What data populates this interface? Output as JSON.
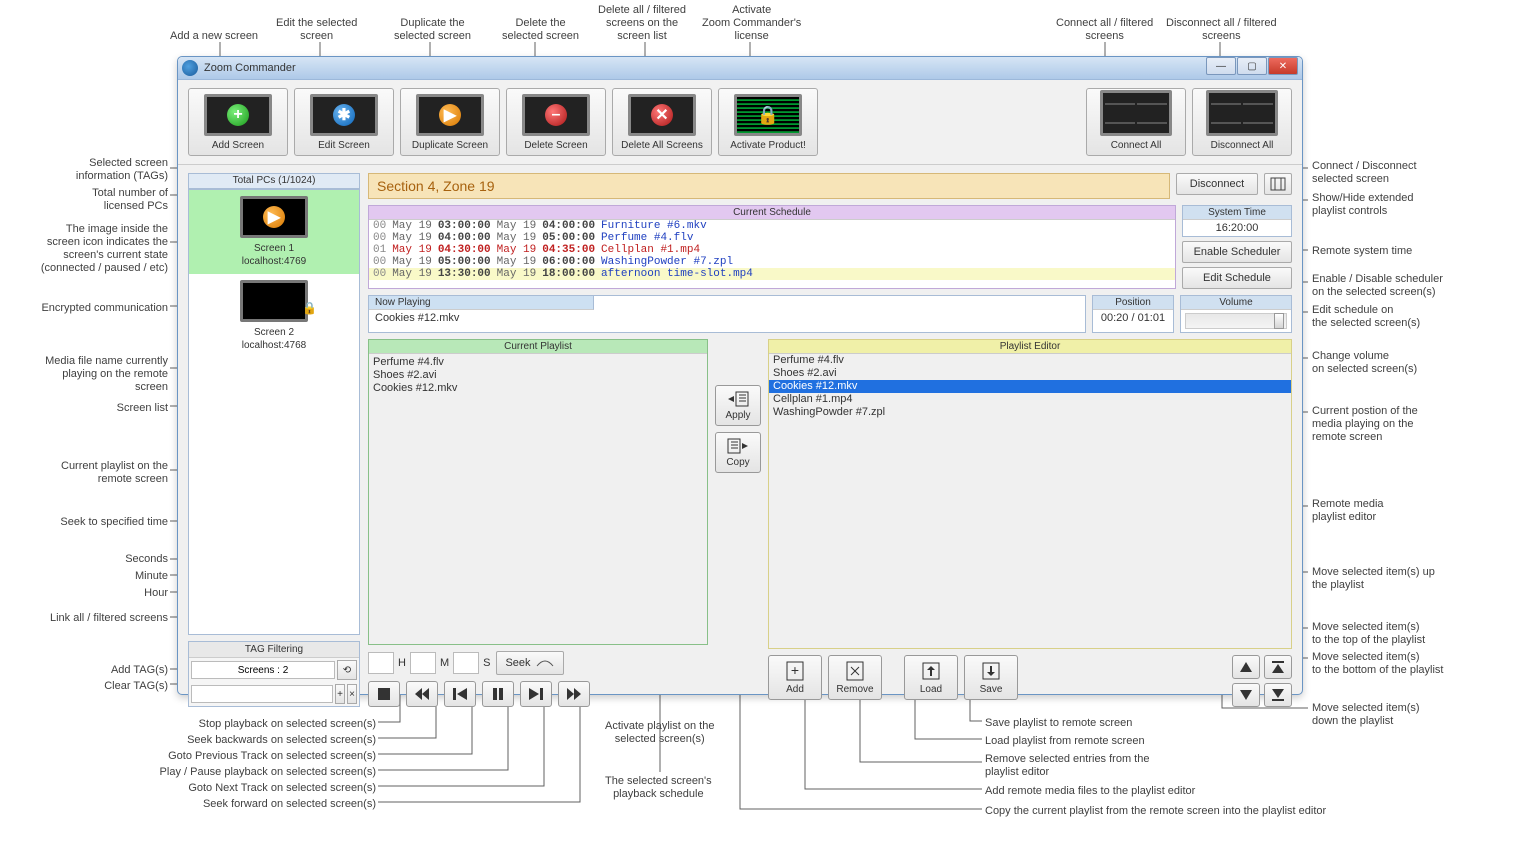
{
  "window": {
    "title": "Zoom Commander"
  },
  "toolbar": {
    "add_screen": "Add Screen",
    "edit_screen": "Edit Screen",
    "duplicate_screen": "Duplicate Screen",
    "delete_screen": "Delete Screen",
    "delete_all": "Delete All Screens",
    "activate": "Activate Product!",
    "connect_all": "Connect All",
    "disconnect_all": "Disconnect All"
  },
  "sidebar": {
    "total_pcs": "Total PCs (1/1024)",
    "screens": [
      {
        "name": "Screen 1",
        "addr": "localhost:4769",
        "active": true
      },
      {
        "name": "Screen 2",
        "addr": "localhost:4768",
        "active": false,
        "locked": true
      }
    ],
    "tag_filter_title": "TAG Filtering",
    "screens_count": "Screens : 2"
  },
  "section_title": "Section 4, Zone 19",
  "schedule": {
    "title": "Current Schedule",
    "rows": [
      {
        "idx": "00",
        "d1": "May 19",
        "t1": "03:00:00",
        "d2": "May 19",
        "t2": "04:00:00",
        "file": "Furniture #6.mkv"
      },
      {
        "idx": "00",
        "d1": "May 19",
        "t1": "04:00:00",
        "d2": "May 19",
        "t2": "05:00:00",
        "file": "Perfume #4.flv"
      },
      {
        "idx": "01",
        "d1": "May 19",
        "t1": "04:30:00",
        "d2": "May 19",
        "t2": "04:35:00",
        "file": "Cellplan #1.mp4",
        "red": true
      },
      {
        "idx": "00",
        "d1": "May 19",
        "t1": "05:00:00",
        "d2": "May 19",
        "t2": "06:00:00",
        "file": "WashingPowder #7.zpl"
      },
      {
        "idx": "00",
        "d1": "May 19",
        "t1": "13:30:00",
        "d2": "May 19",
        "t2": "18:00:00",
        "file": "afternoon time-slot.mp4",
        "hl": true
      }
    ]
  },
  "right": {
    "system_time_label": "System Time",
    "system_time": "16:20:00",
    "disconnect": "Disconnect",
    "enable_scheduler": "Enable Scheduler",
    "edit_schedule": "Edit Schedule",
    "volume_label": "Volume"
  },
  "nowplaying": {
    "label": "Now Playing",
    "file": "Cookies #12.mkv",
    "position_label": "Position",
    "position": "00:20 / 01:01"
  },
  "current_playlist": {
    "title": "Current Playlist",
    "items": [
      "Perfume #4.flv",
      "Shoes #2.avi",
      "Cookies #12.mkv"
    ]
  },
  "mid": {
    "apply": "Apply",
    "copy": "Copy"
  },
  "editor": {
    "title": "Playlist Editor",
    "items": [
      {
        "t": "Perfume #4.flv"
      },
      {
        "t": "Shoes #2.avi"
      },
      {
        "t": "Cookies #12.mkv",
        "sel": true
      },
      {
        "t": "Cellplan #1.mp4"
      },
      {
        "t": "WashingPowder #7.zpl"
      }
    ]
  },
  "seek": {
    "h": "H",
    "m": "M",
    "s": "S",
    "label": "Seek"
  },
  "pl_buttons": {
    "add": "Add",
    "remove": "Remove",
    "load": "Load",
    "save": "Save"
  },
  "callouts": {
    "top": {
      "add": "Add a new screen",
      "edit": "Edit the selected\nscreen",
      "dup": "Duplicate the\nselected screen",
      "del": "Delete the\nselected screen",
      "delall": "Delete all / filtered\nscreens on the\nscreen list",
      "activate": "Activate\nZoom Commander's\nlicense",
      "connall": "Connect all / filtered\nscreens",
      "discall": "Disconnect all / filtered\nscreens"
    },
    "left": {
      "tags": "Selected screen\ninformation (TAGs)",
      "total": "Total number of\nlicensed PCs",
      "state": "The image inside the\nscreen icon indicates the\nscreen's current state\n(connected / paused / etc)",
      "enc": "Encrypted communication",
      "nowplay": "Media file name currently\nplaying on the remote\nscreen",
      "list": "Screen list",
      "curpl": "Current playlist on the\nremote screen",
      "seek": "Seek to specified time",
      "sec": "Seconds",
      "min": "Minute",
      "hour": "Hour",
      "link": "Link all / filtered screens",
      "addtag": "Add TAG(s)",
      "cleartag": "Clear TAG(s)"
    },
    "bottom": {
      "stop": "Stop playback on selected screen(s)",
      "seekb": "Seek backwards on selected screen(s)",
      "prev": "Goto Previous Track on selected screen(s)",
      "play": "Play / Pause playback on selected screen(s)",
      "next": "Goto Next Track on selected screen(s)",
      "seekf": "Seek forward on selected screen(s)",
      "activate_pl": "Activate playlist on the\nselected screen(s)",
      "sched": "The selected screen's\nplayback schedule",
      "savepl": "Save playlist to remote screen",
      "loadpl": "Load playlist from remote screen",
      "removepl": "Remove selected entries from the\nplaylist editor",
      "addpl": "Add remote media files to the playlist editor",
      "copypl": "Copy the current playlist from the remote screen into the playlist editor"
    },
    "right": {
      "conn": "Connect / Disconnect\nselected screen",
      "ext": "Show/Hide extended\nplaylist controls",
      "systime": "Remote system time",
      "sched": "Enable / Disable scheduler\non the selected screen(s)",
      "editsched": "Edit schedule on\nthe selected screen(s)",
      "vol": "Change volume\non selected screen(s)",
      "pos": "Current postion of the\nmedia playing on the\nremote screen",
      "editor": "Remote media\nplaylist editor",
      "moveup": "Move selected item(s) up\nthe playlist",
      "movetop": "Move selected item(s)\nto the top of the playlist",
      "movebot": "Move selected item(s)\nto the bottom of the playlist",
      "movedown": "Move selected item(s)\ndown the playlist"
    }
  }
}
